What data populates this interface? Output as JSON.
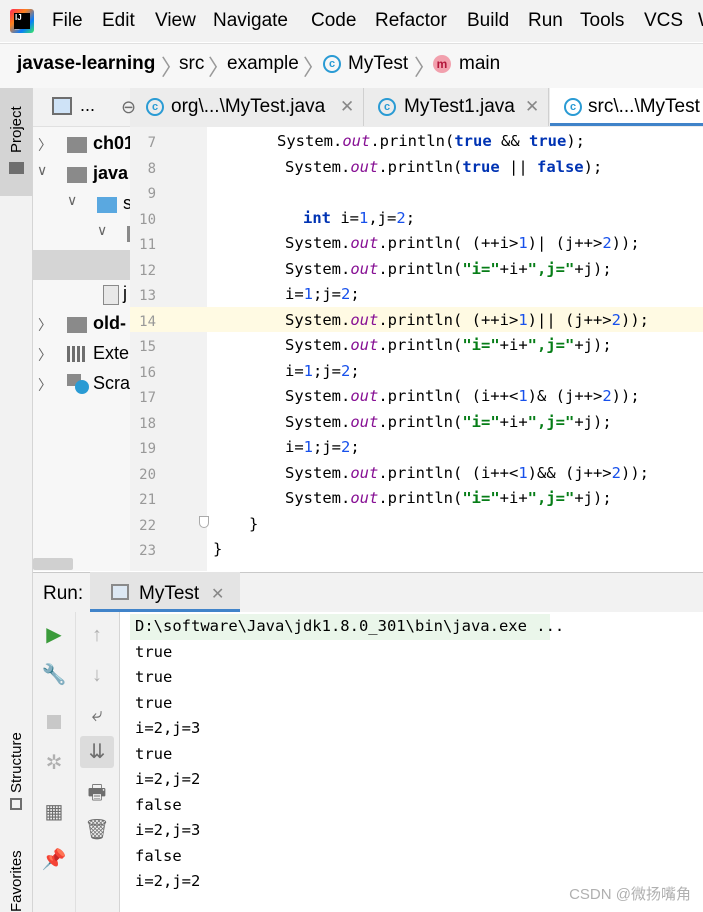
{
  "menu": [
    "File",
    "Edit",
    "View",
    "Navigate",
    "Code",
    "Refactor",
    "Build",
    "Run",
    "Tools",
    "VCS",
    "W"
  ],
  "breadcrumb": [
    "javase-learning",
    "src",
    "example",
    "MyTest",
    "main"
  ],
  "project_panel": {
    "tab_label": "Project",
    "header_label": "...",
    "tree": [
      "ch01",
      "java",
      "s",
      "",
      "j",
      "old-",
      "Exte",
      "Scra"
    ]
  },
  "side_tabs": {
    "structure": "Structure",
    "favorites": "Favorites"
  },
  "tabs": [
    "org\\...\\MyTest.java",
    "MyTest1.java",
    "src\\...\\MyTest"
  ],
  "line_numbers": [
    "7",
    "8",
    "9",
    "10",
    "11",
    "12",
    "13",
    "14",
    "15",
    "16",
    "17",
    "18",
    "19",
    "20",
    "21",
    "22",
    "23"
  ],
  "code_lines": [
    "System.out.println(true && true);",
    "System.out.println(true || false);",
    "",
    "int i=1,j=2;",
    "System.out.println( (++i>1)| (j++>2));",
    "System.out.println(\"i=\"+i+\",j=\"+j);",
    "i=1;j=2;",
    "System.out.println( (++i>1)|| (j++>2));",
    "System.out.println(\"i=\"+i+\",j=\"+j);",
    "i=1;j=2;",
    "System.out.println( (i++<1)& (j++>2));",
    "System.out.println(\"i=\"+i+\",j=\"+j);",
    "i=1;j=2;",
    "System.out.println( (i++<1)&& (j++>2));",
    "System.out.println(\"i=\"+i+\",j=\"+j);",
    "}",
    "}"
  ],
  "run": {
    "label": "Run:",
    "tab": "MyTest",
    "output": [
      "D:\\software\\Java\\jdk1.8.0_301\\bin\\java.exe ...",
      "true",
      "true",
      "true",
      "i=2,j=3",
      "true",
      "i=2,j=2",
      "false",
      "i=2,j=3",
      "false",
      "i=2,j=2"
    ]
  },
  "watermark": "CSDN @微扬嘴角",
  "colors": {
    "keyword": "#0033b3",
    "string": "#067d17",
    "field": "#871094",
    "number": "#1750eb",
    "current_line": "#fffae3"
  }
}
